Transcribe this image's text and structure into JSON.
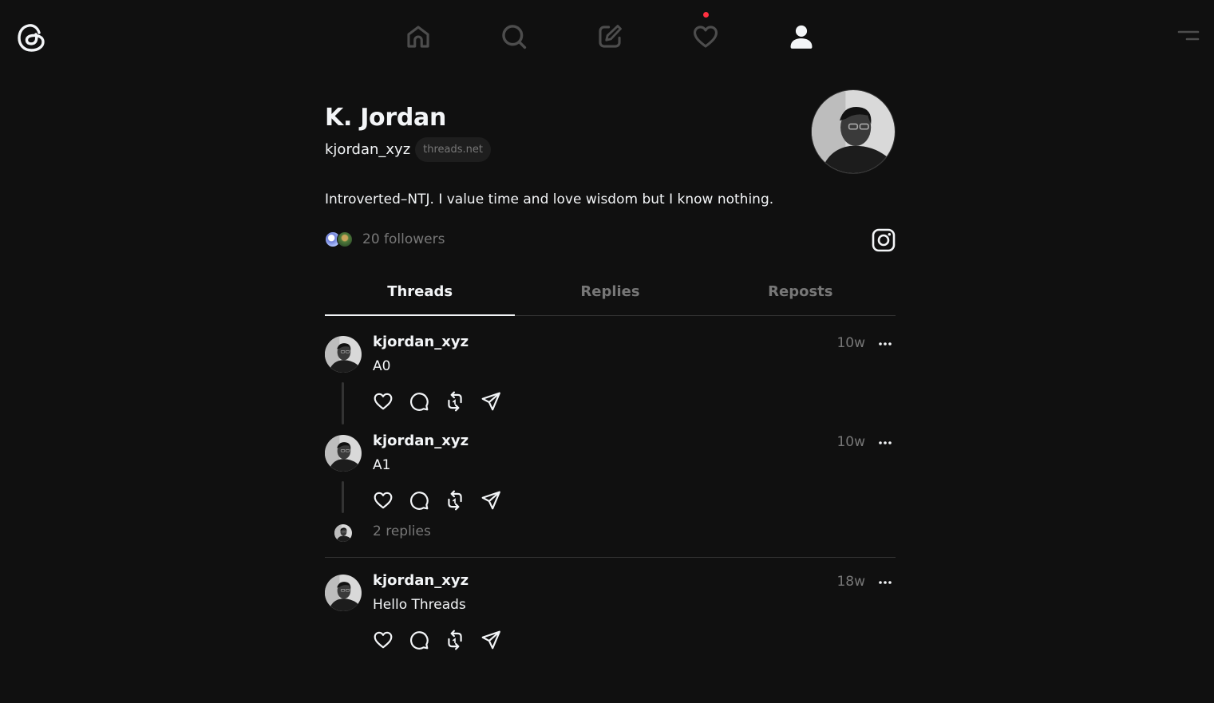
{
  "colors": {
    "background": "#101010",
    "text_primary": "#f3f5f7",
    "text_secondary": "#777777",
    "divider": "#333333",
    "notification_dot": "#ff3040"
  },
  "nav": {
    "logo_icon": "threads-logo-icon",
    "items": [
      {
        "icon": "home-icon",
        "active": false
      },
      {
        "icon": "search-icon",
        "active": false
      },
      {
        "icon": "compose-icon",
        "active": false
      },
      {
        "icon": "heart-icon",
        "active": false,
        "notification": true
      },
      {
        "icon": "profile-icon",
        "active": true
      }
    ],
    "menu_icon": "menu-icon"
  },
  "profile": {
    "name": "K. Jordan",
    "handle": "kjordan_xyz",
    "badge": "threads.net",
    "bio": "Introverted–NTJ. I value time and love wisdom but I know nothing.",
    "followers": "20 followers",
    "instagram_icon": "instagram-icon"
  },
  "tabs": [
    {
      "label": "Threads",
      "active": true
    },
    {
      "label": "Replies",
      "active": false
    },
    {
      "label": "Reposts",
      "active": false
    }
  ],
  "posts": [
    {
      "username": "kjordan_xyz",
      "time": "10w",
      "text": "A0"
    },
    {
      "username": "kjordan_xyz",
      "time": "10w",
      "text": "A1",
      "replies": "2 replies"
    },
    {
      "username": "kjordan_xyz",
      "time": "18w",
      "text": "Hello Threads"
    }
  ],
  "action_icons": [
    "like-icon",
    "comment-icon",
    "repost-icon",
    "share-icon"
  ]
}
